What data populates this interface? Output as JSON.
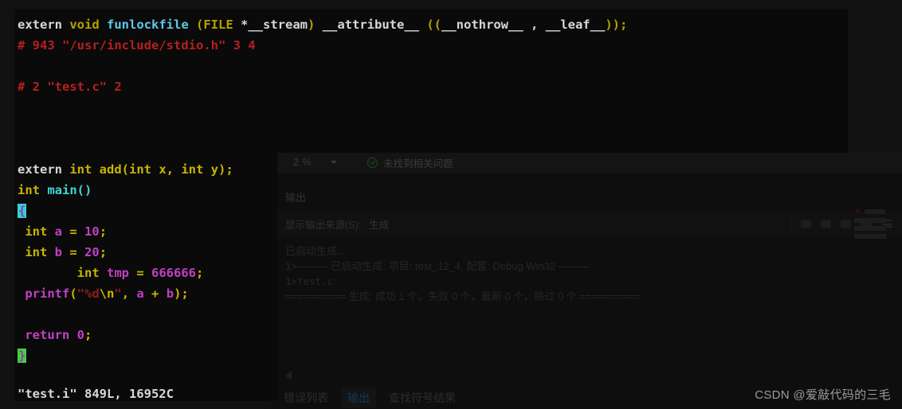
{
  "terminal": {
    "app": "vim",
    "background": "#0a0a0a",
    "lines": [
      {
        "id": "line-extern-funlockfile",
        "tokens": [
          {
            "t": "extern ",
            "c": "c-white"
          },
          {
            "t": "void ",
            "c": "c-olive"
          },
          {
            "t": "funlockfile ",
            "c": "c-ltblue"
          },
          {
            "t": "(",
            "c": "c-olive"
          },
          {
            "t": "FILE ",
            "c": "c-olive"
          },
          {
            "t": "*__stream",
            "c": "c-white"
          },
          {
            "t": ")",
            "c": "c-olive"
          },
          {
            "t": " __attribute__ ",
            "c": "c-white"
          },
          {
            "t": "((",
            "c": "c-olive"
          },
          {
            "t": "__nothrow__ , __leaf__",
            "c": "c-white"
          },
          {
            "t": "))",
            "c": "c-olive"
          },
          {
            "t": ";",
            "c": "c-olive"
          }
        ]
      },
      {
        "id": "line-directive-stdio",
        "tokens": [
          {
            "t": "# 943 \"/usr/include/stdio.h\" 3 4",
            "c": "c-red"
          }
        ]
      },
      {
        "id": "line-blank-1",
        "tokens": [
          {
            "t": " ",
            "c": "c-white"
          }
        ]
      },
      {
        "id": "line-directive-testc",
        "tokens": [
          {
            "t": "# 2 \"test.c\" 2",
            "c": "c-red"
          }
        ]
      },
      {
        "id": "line-blank-2",
        "tokens": [
          {
            "t": " ",
            "c": "c-white"
          }
        ]
      },
      {
        "id": "line-blank-3",
        "tokens": [
          {
            "t": " ",
            "c": "c-white"
          }
        ]
      },
      {
        "id": "line-blank-4",
        "tokens": [
          {
            "t": " ",
            "c": "c-white"
          }
        ]
      },
      {
        "id": "line-extern-add",
        "tokens": [
          {
            "t": "extern ",
            "c": "c-white"
          },
          {
            "t": "int ",
            "c": "c-yellow"
          },
          {
            "t": "add",
            "c": "c-yellow"
          },
          {
            "t": "(",
            "c": "c-yellow"
          },
          {
            "t": "int ",
            "c": "c-yellow"
          },
          {
            "t": "x",
            "c": "c-yellow"
          },
          {
            "t": ", ",
            "c": "c-yellow"
          },
          {
            "t": "int ",
            "c": "c-yellow"
          },
          {
            "t": "y",
            "c": "c-yellow"
          },
          {
            "t": ")",
            "c": "c-yellow"
          },
          {
            "t": ";",
            "c": "c-yellow"
          }
        ]
      },
      {
        "id": "line-int-main",
        "tokens": [
          {
            "t": "int ",
            "c": "c-yellow"
          },
          {
            "t": "main",
            "c": "c-cyan"
          },
          {
            "t": "()",
            "c": "c-cyan"
          }
        ]
      },
      {
        "id": "line-open-brace",
        "tokens": [
          {
            "t": "{",
            "c": "brace-open"
          }
        ]
      },
      {
        "id": "line-int-a",
        "tokens": [
          {
            "t": " ",
            "c": "c-white"
          },
          {
            "t": "int ",
            "c": "c-yellow"
          },
          {
            "t": "a",
            "c": "c-magenta"
          },
          {
            "t": " = ",
            "c": "c-yellow"
          },
          {
            "t": "10",
            "c": "c-magenta"
          },
          {
            "t": ";",
            "c": "c-yellow"
          }
        ]
      },
      {
        "id": "line-int-b",
        "tokens": [
          {
            "t": " ",
            "c": "c-white"
          },
          {
            "t": "int ",
            "c": "c-yellow"
          },
          {
            "t": "b",
            "c": "c-magenta"
          },
          {
            "t": " = ",
            "c": "c-yellow"
          },
          {
            "t": "20",
            "c": "c-magenta"
          },
          {
            "t": ";",
            "c": "c-yellow"
          }
        ]
      },
      {
        "id": "line-int-tmp",
        "tokens": [
          {
            "t": "        ",
            "c": "c-white"
          },
          {
            "t": "int ",
            "c": "c-yellow"
          },
          {
            "t": "tmp",
            "c": "c-magenta"
          },
          {
            "t": " = ",
            "c": "c-yellow"
          },
          {
            "t": "666666",
            "c": "c-magenta"
          },
          {
            "t": ";",
            "c": "c-yellow"
          }
        ]
      },
      {
        "id": "line-printf",
        "tokens": [
          {
            "t": " ",
            "c": "c-white"
          },
          {
            "t": "printf",
            "c": "c-magenta"
          },
          {
            "t": "(",
            "c": "c-yellow"
          },
          {
            "t": "\"%d",
            "c": "c-darkred"
          },
          {
            "t": "\\n",
            "c": "c-yellow"
          },
          {
            "t": "\"",
            "c": "c-darkred"
          },
          {
            "t": ", ",
            "c": "c-yellow"
          },
          {
            "t": "a",
            "c": "c-magenta"
          },
          {
            "t": " + ",
            "c": "c-yellow"
          },
          {
            "t": "b",
            "c": "c-magenta"
          },
          {
            "t": ")",
            "c": "c-yellow"
          },
          {
            "t": ";",
            "c": "c-yellow"
          }
        ]
      },
      {
        "id": "line-blank-5",
        "tokens": [
          {
            "t": " ",
            "c": "c-white"
          }
        ]
      },
      {
        "id": "line-return",
        "tokens": [
          {
            "t": " ",
            "c": "c-white"
          },
          {
            "t": "return ",
            "c": "c-magenta"
          },
          {
            "t": "0",
            "c": "c-magenta"
          },
          {
            "t": ";",
            "c": "c-yellow"
          }
        ]
      },
      {
        "id": "line-close-brace",
        "tokens": [
          {
            "t": "}",
            "c": "brace-close"
          }
        ]
      }
    ],
    "status_line": "\"test.i\" 849L, 16952C"
  },
  "vs": {
    "editor_statusbar": {
      "zoom_level": "2 %",
      "issue_status": "未找到相关问题",
      "issue_icon": "check-circle-icon",
      "caret_icon": "chevron-down-icon"
    },
    "output_panel": {
      "title": "输出",
      "source_label": "显示输出来源(S):",
      "source_value": "生成",
      "lines": [
        {
          "id": "out-line-1",
          "text": "已启动生成…",
          "cn": true
        },
        {
          "id": "out-line-2",
          "text": "1>——— 已启动生成: 项目: test_12_4, 配置: Debug Win32 ———",
          "cn": true
        },
        {
          "id": "out-line-3",
          "text": "1>test.c",
          "cn": false
        },
        {
          "id": "out-line-4",
          "text": "========== 生成: 成功 1 个，失败 0 个，最新 0 个，跳过 0 个 ==========",
          "cn": true
        }
      ]
    },
    "bottom_tabs": [
      {
        "id": "tab-error-list",
        "label": "错误列表",
        "active": false
      },
      {
        "id": "tab-output",
        "label": "输出",
        "active": true
      },
      {
        "id": "tab-find-symbol-results",
        "label": "查找符号结果",
        "active": false
      }
    ],
    "scroll_left_icon": "triangle-left-icon"
  },
  "watermark": {
    "text": "CSDN @爱敲代码的三毛"
  },
  "colors": {
    "terminal_bg": "#0a0a0a",
    "vs_bg": "#111111",
    "accent_tab_active": "#123a52",
    "brace_match_open_bg": "#2fd4d4",
    "brace_match_close_bg": "#3fd23f",
    "preprocessor_red": "#b81f1f"
  }
}
